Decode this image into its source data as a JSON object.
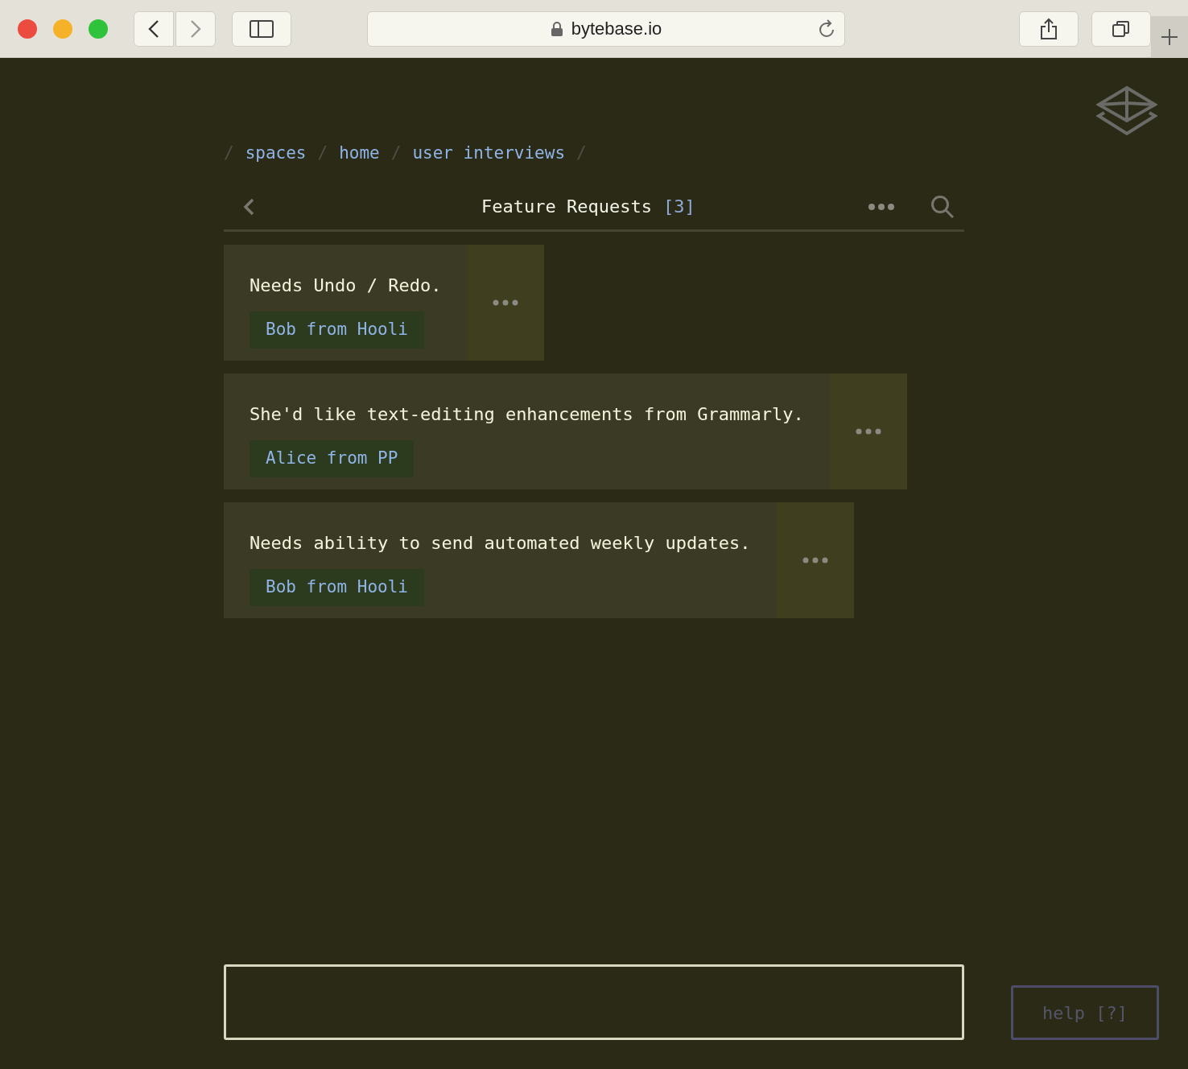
{
  "browser": {
    "address": "bytebase.io"
  },
  "breadcrumbs": [
    {
      "kind": "separator",
      "text": "/"
    },
    {
      "kind": "link",
      "text": "spaces"
    },
    {
      "kind": "separator",
      "text": "/"
    },
    {
      "kind": "link",
      "text": "home"
    },
    {
      "kind": "separator",
      "text": "/"
    },
    {
      "kind": "link",
      "text": "user interviews"
    },
    {
      "kind": "separator",
      "text": "/"
    }
  ],
  "header": {
    "title": "Feature Requests",
    "count": "[3]"
  },
  "cards": [
    {
      "text": "Needs Undo / Redo.",
      "tag": "Bob from Hooli"
    },
    {
      "text": "She'd like text-editing enhancements from Grammarly.",
      "tag": "Alice from PP"
    },
    {
      "text": "Needs ability to send automated weekly updates.",
      "tag": "Bob from Hooli"
    }
  ],
  "help_button": "help [?]"
}
